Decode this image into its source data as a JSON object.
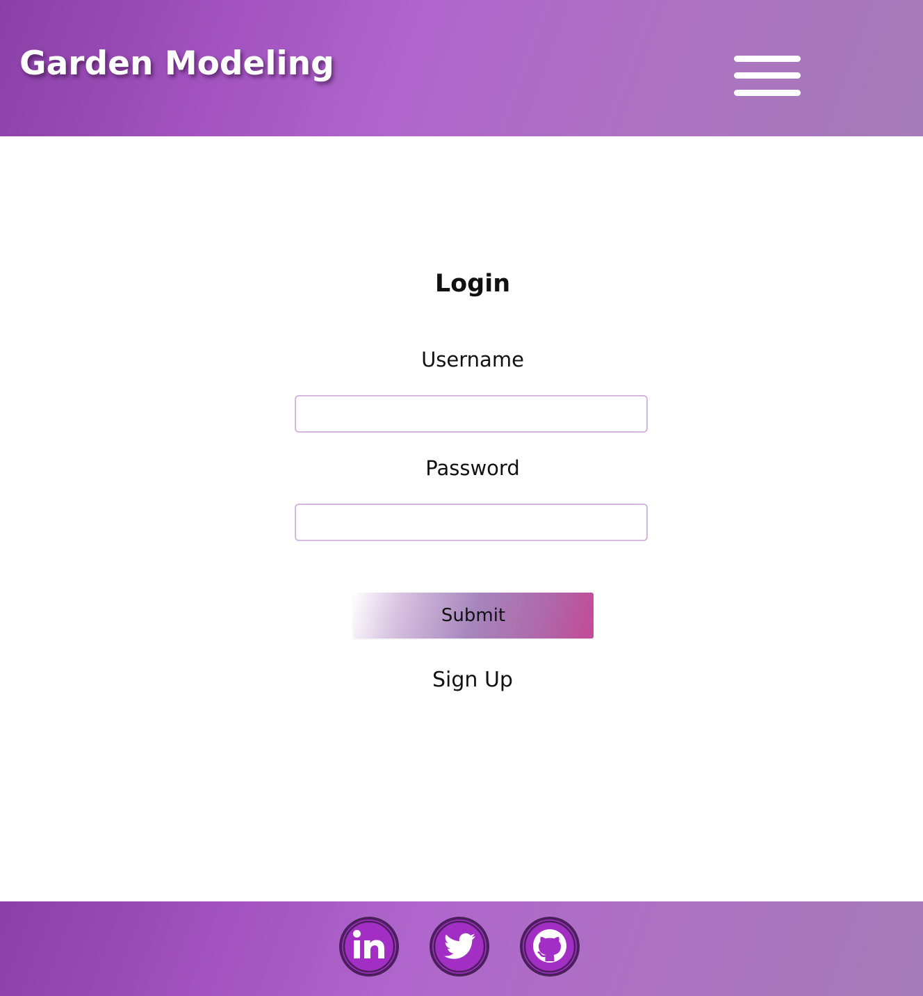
{
  "header": {
    "brand": "Garden Modeling",
    "menu_icon": "hamburger-menu-icon"
  },
  "login": {
    "title": "Login",
    "username_label": "Username",
    "username_value": "",
    "password_label": "Password",
    "password_value": "",
    "submit_label": "Submit",
    "signup_label": "Sign Up"
  },
  "footer": {
    "social_links": [
      {
        "icon": "linkedin-icon"
      },
      {
        "icon": "twitter-icon"
      },
      {
        "icon": "github-icon"
      }
    ]
  },
  "colors": {
    "header_gradient_start": "#8a3fa6",
    "header_gradient_mid": "#b066cc",
    "header_gradient_end": "#a67cb8",
    "social_icon_fill": "#a22ec4",
    "social_icon_ring": "#4a1f5c",
    "input_border": "#d3b8dc",
    "submit_gradient_end": "#c44a95"
  }
}
